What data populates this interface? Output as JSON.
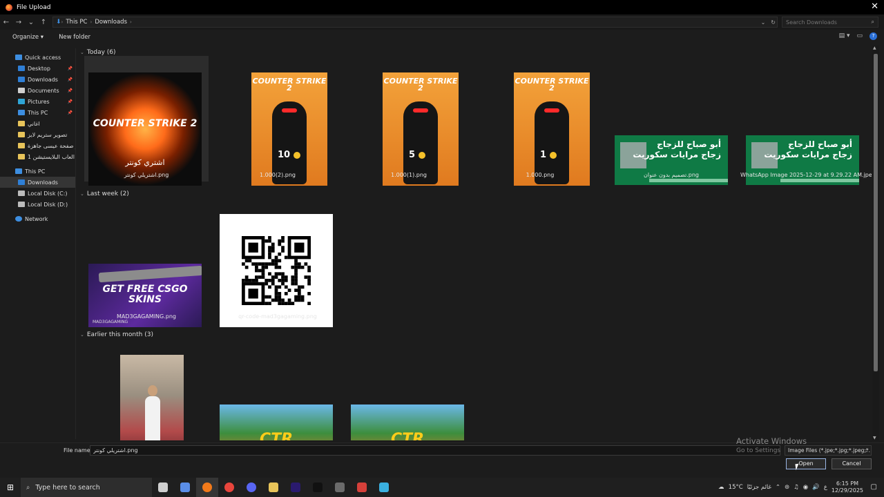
{
  "window": {
    "title": "File Upload",
    "close_glyph": "✕"
  },
  "nav": {
    "back": "←",
    "forward": "→",
    "recent": "⌄",
    "up": "↑",
    "breadcrumb": [
      "This PC",
      "Downloads"
    ],
    "search_placeholder": "Search Downloads"
  },
  "toolbar": {
    "organize_label": "Organize ▾",
    "new_folder_label": "New folder"
  },
  "sidebar": {
    "items": [
      {
        "label": "Quick access",
        "icon": "star-icon",
        "color": "#3d8ee0",
        "pinned": false
      },
      {
        "label": "Desktop",
        "icon": "desktop-icon",
        "color": "#2f7fd6",
        "pinned": true
      },
      {
        "label": "Downloads",
        "icon": "download-icon",
        "color": "#2f7fd6",
        "pinned": true
      },
      {
        "label": "Documents",
        "icon": "document-icon",
        "color": "#cfcfcf",
        "pinned": true
      },
      {
        "label": "Pictures",
        "icon": "pictures-icon",
        "color": "#2fa5d6",
        "pinned": true
      },
      {
        "label": "This PC",
        "icon": "computer-icon",
        "color": "#3d8ee0",
        "pinned": true
      },
      {
        "label": "اغاني",
        "icon": "folder-icon",
        "color": "#e8c45a",
        "pinned": false
      },
      {
        "label": "تصوير ستريم لايز",
        "icon": "folder-icon",
        "color": "#e8c45a",
        "pinned": false
      },
      {
        "label": "ير صفحة عيسى جاهزة",
        "icon": "folder-icon",
        "color": "#e8c45a",
        "pinned": false
      },
      {
        "label": "العاب البلايستيشن 1",
        "icon": "folder-icon",
        "color": "#e8c45a",
        "pinned": false
      }
    ],
    "this_pc": {
      "label": "This PC",
      "icon": "computer-icon",
      "color": "#3d8ee0"
    },
    "pc_items": [
      {
        "label": "Downloads",
        "icon": "download-icon",
        "color": "#2f7fd6",
        "selected": true
      },
      {
        "label": "Local Disk (C:)",
        "icon": "drive-icon",
        "color": "#bcbcbc",
        "selected": false
      },
      {
        "label": "Local Disk (D:)",
        "icon": "drive-icon",
        "color": "#bcbcbc",
        "selected": false
      }
    ],
    "network": {
      "label": "Network",
      "icon": "network-icon",
      "color": "#3d8ee0"
    }
  },
  "groups": {
    "today": "Today (6)",
    "last_week": "Last week (2)",
    "earlier": "Earlier this month (3)"
  },
  "files": {
    "today": [
      {
        "name": "اشتريلي كونتر.png",
        "kind": "fire",
        "logo": "COUNTER STRIKE 2",
        "sub": "اشتري كونتر",
        "selected": true
      },
      {
        "name": "1.000(2).png",
        "kind": "cs",
        "logo": "COUNTER STRIKE 2",
        "num": "10"
      },
      {
        "name": "1.000(1).png",
        "kind": "cs",
        "logo": "COUNTER STRIKE 2",
        "num": "5"
      },
      {
        "name": "1.000.png",
        "kind": "cs",
        "logo": "COUNTER STRIKE 2",
        "num": "1"
      },
      {
        "name": "تصميم بدون عنوان.png",
        "kind": "banner",
        "line1": "أبو صباح للزجاج",
        "line2": "زجاج مرايات سكوريت"
      },
      {
        "name": "WhatsApp Image 2025-12-29 at 9.29.22 AM.jpeg",
        "kind": "banner",
        "line1": "أبو صباح للزجاج",
        "line2": "زجاج مرايات سكوريت"
      }
    ],
    "last_week": [
      {
        "name": "MAD3GAGAMING.png",
        "kind": "skins",
        "text": "GET FREE CSGO SKINS",
        "brand": "MAD3GAGAMING"
      },
      {
        "name": "qr-code-mad3gagaming.png",
        "kind": "qr"
      }
    ],
    "earlier": [
      {
        "kind": "photo"
      },
      {
        "kind": "ctr",
        "text": "CTR"
      },
      {
        "kind": "ctr",
        "text": "CTR"
      }
    ]
  },
  "bottom": {
    "file_name_label": "File name:",
    "file_name_value": "اشتريلي كونتر.png",
    "file_type": "Image Files (*.jpe;*.jpg;*.jpeg;*.",
    "open_label": "Open",
    "cancel_label": "Cancel",
    "watermark_title": "Activate Windows",
    "watermark_sub": "Go to Settings"
  },
  "taskbar": {
    "search_placeholder": "Type here to search",
    "weather": "15°C",
    "weather_text": "غائم جزئيًا",
    "lang": "ع",
    "time": "6:15 PM",
    "date": "12/29/2025",
    "apps": [
      {
        "icon": "task-view-icon",
        "color": "#cfcfcf",
        "active": false
      },
      {
        "icon": "copilot-icon",
        "color": "#5a8ee8",
        "active": false
      },
      {
        "icon": "firefox-icon",
        "color": "#f27a1a",
        "active": true
      },
      {
        "icon": "chrome-icon",
        "color": "#e8453c",
        "active": false
      },
      {
        "icon": "discord-icon",
        "color": "#5865f2",
        "active": false
      },
      {
        "icon": "file-explorer-icon",
        "color": "#e8c45a",
        "active": false
      },
      {
        "icon": "premiere-icon",
        "color": "#2a1a6e",
        "active": false
      },
      {
        "icon": "capcut-icon",
        "color": "#111111",
        "active": false
      },
      {
        "icon": "steam-icon",
        "color": "#6b6b6b",
        "active": false
      },
      {
        "icon": "shield-icon",
        "color": "#d6403a",
        "active": false
      },
      {
        "icon": "screen-icon",
        "color": "#3ab0e0",
        "active": false
      }
    ]
  }
}
